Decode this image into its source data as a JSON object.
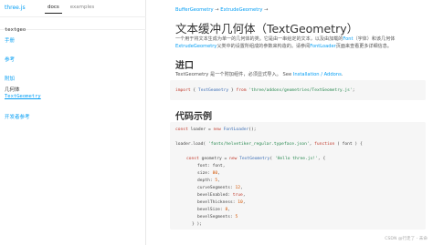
{
  "sidebar": {
    "brand": "three.js",
    "tabs": [
      "docs",
      "examples"
    ],
    "search_value": "textgeo",
    "sections": [
      {
        "label": "手册"
      },
      {
        "label": "参考"
      },
      {
        "label": "附加"
      },
      {
        "label": "几何体"
      },
      {
        "label": "TextGeometry"
      },
      {
        "label": "开发者参考"
      }
    ]
  },
  "main": {
    "breadcrumb": {
      "parent": "BufferGeometry",
      "arrow": "→",
      "current": "ExtrudeGeometry",
      "arrow2": "→"
    },
    "title": "文本缓冲几何体（TextGeometry）",
    "desc": {
      "part1": "一个用于将文本生成为单一的几何体的类。它是由一串给定的文本，以及由加载的",
      "font": "Font",
      "part2": "（字体）和该几何体",
      "extrude": "ExtrudeGeometry",
      "part3": "父类中的设置所组成的参数来构造的。请参阅",
      "fontloader": "FontLoader",
      "part4": "页面来查看更多详细信息。"
    },
    "import_heading": "进口",
    "import_desc": {
      "text": "TextGeometry 是一个附加组件，必须显式导入。 See",
      "link": "Installation / Addons",
      "end": "."
    },
    "import_code": {
      "kw": "import",
      "brace_open": " { ",
      "cls": "TextGeometry",
      "brace_close": " } ",
      "from": "from",
      "path": " 'three/addons/geometries/TextGeometry.js'",
      "semi": ";"
    },
    "example_heading": "代码示例",
    "code": {
      "l1_kw": "const",
      "l1_a": " loader = ",
      "l1_new": "new",
      "l1_cls": " FontLoader",
      "l1_b": "();",
      "l2_a": "loader.load( ",
      "l2_str": "'fonts/helvetiker_regular.typeface.json'",
      "l2_b": ", ",
      "l2_fn": "function",
      "l2_c": " ( font ) {",
      "l3_kw": "const",
      "l3_a": " geometry = ",
      "l3_new": "new",
      "l3_cls": " TextGeometry",
      "l3_b": "( ",
      "l3_str": "'Hello three.js!'",
      "l3_c": ", {",
      "props": [
        {
          "key": "font: ",
          "val": "font",
          "type": "plain"
        },
        {
          "key": "size: ",
          "val": "80",
          "type": "num"
        },
        {
          "key": "depth: ",
          "val": "5",
          "type": "num"
        },
        {
          "key": "curveSegments: ",
          "val": "12",
          "type": "num"
        },
        {
          "key": "bevelEnabled: ",
          "val": "true",
          "type": "kw"
        },
        {
          "key": "bevelThickness: ",
          "val": "10",
          "type": "num"
        },
        {
          "key": "bevelSize: ",
          "val": "8",
          "type": "num"
        },
        {
          "key": "bevelSegments: ",
          "val": "5",
          "type": "num"
        }
      ],
      "close1": "} );",
      "close2": "} );"
    }
  },
  "footer": "CSDN @行走了 - 未命"
}
